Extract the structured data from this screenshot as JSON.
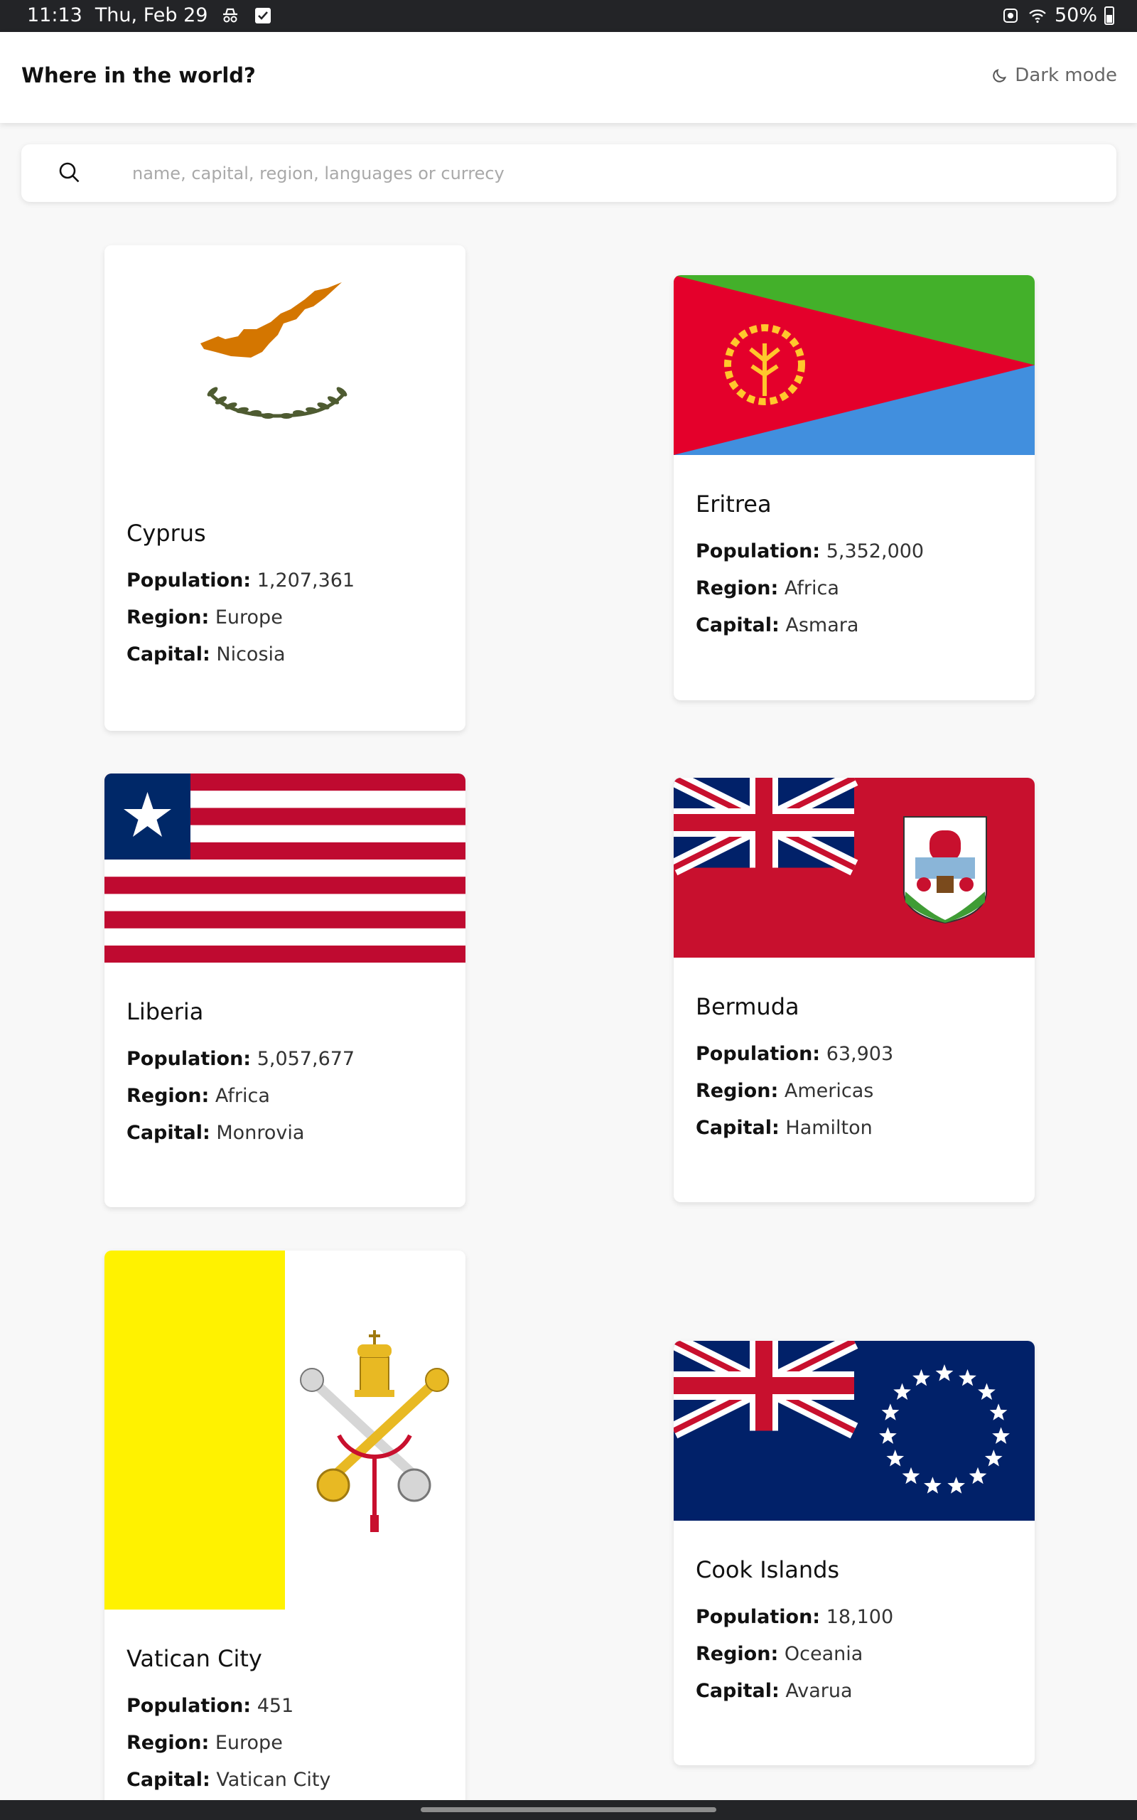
{
  "status_bar": {
    "time": "11:13",
    "date": "Thu, Feb 29",
    "battery": "50%"
  },
  "header": {
    "title": "Where in the world?",
    "dark_mode_label": "Dark mode"
  },
  "search": {
    "placeholder": "name, capital, region, languages or currecy",
    "value": ""
  },
  "labels": {
    "population": "Population:",
    "region": "Region:",
    "capital": "Capital:"
  },
  "countries": [
    {
      "name": "Cyprus",
      "population": "1,207,361",
      "region": "Europe",
      "capital": "Nicosia"
    },
    {
      "name": "Eritrea",
      "population": "5,352,000",
      "region": "Africa",
      "capital": "Asmara"
    },
    {
      "name": "Liberia",
      "population": "5,057,677",
      "region": "Africa",
      "capital": "Monrovia"
    },
    {
      "name": "Bermuda",
      "population": "63,903",
      "region": "Americas",
      "capital": "Hamilton"
    },
    {
      "name": "Vatican City",
      "population": "451",
      "region": "Europe",
      "capital": "Vatican City"
    },
    {
      "name": "Cook Islands",
      "population": "18,100",
      "region": "Oceania",
      "capital": "Avarua"
    }
  ],
  "colors": {
    "background": "#f8f8f8",
    "card": "#ffffff",
    "header": "#ffffff",
    "status_bar": "#232427"
  },
  "icons": {
    "search": "magnifier-icon",
    "dark_mode": "moon-icon"
  }
}
